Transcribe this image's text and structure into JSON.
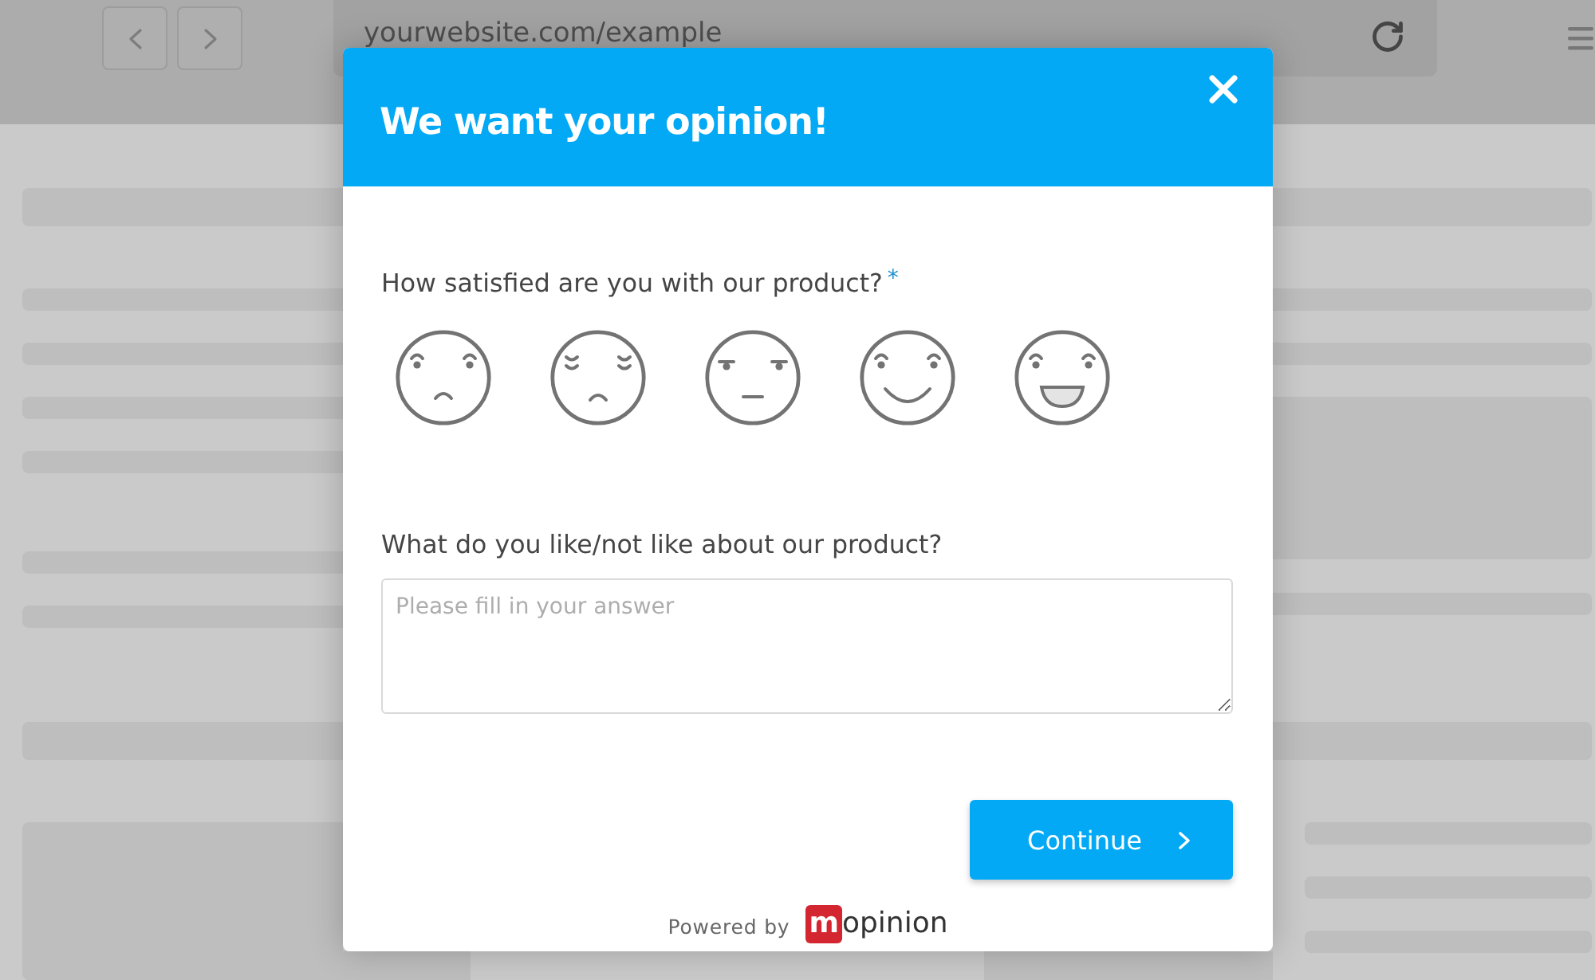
{
  "browser": {
    "url": "yourwebsite.com/example"
  },
  "survey": {
    "title": "We want your opinion!",
    "questions": [
      {
        "kind": "rating",
        "label": "How satisfied are you with our product?",
        "required_mark": "*",
        "options": [
          {
            "kind": "frowning",
            "selected": false
          },
          {
            "kind": "sad",
            "selected": false
          },
          {
            "kind": "neutral",
            "selected": false
          },
          {
            "kind": "smiling",
            "selected": false
          },
          {
            "kind": "grinning",
            "selected": false
          }
        ]
      },
      {
        "kind": "text",
        "label": "What do you like/not like about our product?",
        "placeholder": "Please fill in your answer"
      }
    ],
    "continue_button": "Continue",
    "footer": {
      "powered_by": "Powered by",
      "logo_mark": "m",
      "logo_text": "opinion"
    }
  }
}
